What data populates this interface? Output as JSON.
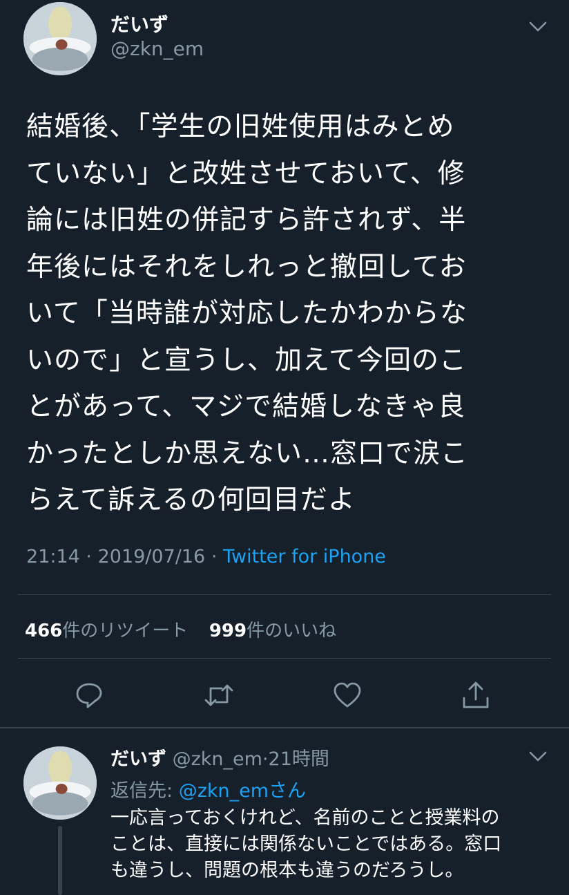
{
  "tweet": {
    "display_name": "だいず",
    "handle": "@zkn_em",
    "text": "結婚後、「学生の旧姓使用はみとめ\nていない」と改姓させておいて、修\n論には旧姓の併記すら許されず、半\n年後にはそれをしれっと撤回してお\nいて「当時誰が対応したかわからな\nいので」と宣うし、加えて今回のこ\nとがあって、マジで結婚しなきゃ良\nかったとしか思えない…窓口で涙こ\nらえて訴えるの何回目だよ",
    "time": "21:14",
    "date": "2019/07/16",
    "sep": "·",
    "source": "Twitter for iPhone",
    "retweet_count": "466",
    "retweet_label": "件のリツイート",
    "like_count": "999",
    "like_label": "件のいいね"
  },
  "actions": [
    {
      "name": "reply",
      "icon": "reply-icon"
    },
    {
      "name": "retweet",
      "icon": "retweet-icon"
    },
    {
      "name": "like",
      "icon": "heart-icon"
    },
    {
      "name": "share",
      "icon": "share-icon"
    }
  ],
  "reply": {
    "display_name": "だいず",
    "handle": "@zkn_em",
    "sep": "·",
    "age": "21時間",
    "reply_to_prefix": "返信先: ",
    "reply_to_handle": "@zkn_emさん",
    "text": "一応言っておくけれど、名前のことと授業料の\nことは、直接には関係ないことではある。窓口\nも違うし、問題の根本も違うのだろうし。"
  },
  "colors": {
    "background": "#15202b",
    "text": "#ffffff",
    "muted": "#8899a6",
    "accent": "#1da1f2",
    "divider": "#38444d"
  }
}
